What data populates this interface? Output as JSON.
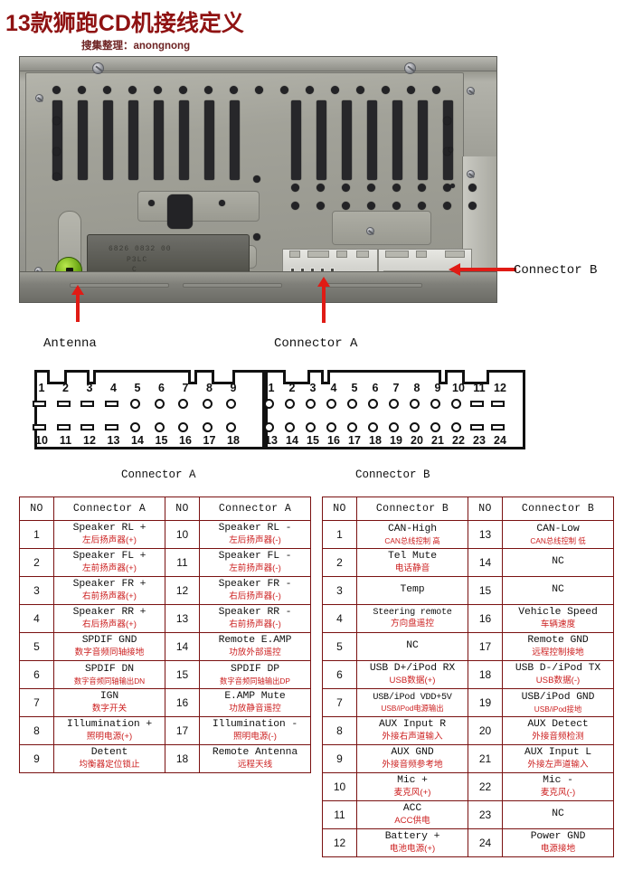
{
  "header": {
    "title": "13款狮跑CD机接线定义",
    "subtitle": "搜集整理：anongnong",
    "title_color": "#8f1212",
    "accent_red": "#cc1f1f",
    "table_border_color": "#7a1111"
  },
  "photo": {
    "alt_name": "car-cd-unit-rear-photo",
    "plate_text_line1": "6826 0832 00",
    "plate_text_line2": "P3LC",
    "plate_text_line3": "C",
    "labels": {
      "antenna": "Antenna",
      "connector_a": "Connector A",
      "connector_b": "Connector B"
    }
  },
  "pinout_diagram": {
    "connector_a": {
      "caption": "Connector A",
      "top_row": [
        "1",
        "2",
        "3",
        "4",
        "5",
        "6",
        "7",
        "8",
        "9"
      ],
      "bottom_row": [
        "10",
        "11",
        "12",
        "13",
        "14",
        "15",
        "16",
        "17",
        "18"
      ],
      "top_shapes": [
        "rect",
        "rect",
        "rect",
        "rect",
        "circle",
        "circle",
        "circle",
        "circle",
        "circle"
      ],
      "bottom_shapes": [
        "rect",
        "rect",
        "rect",
        "rect",
        "circle",
        "circle",
        "circle",
        "circle",
        "circle"
      ]
    },
    "connector_b": {
      "caption": "Connector B",
      "top_row": [
        "1",
        "2",
        "3",
        "4",
        "5",
        "6",
        "7",
        "8",
        "9",
        "10",
        "11",
        "12"
      ],
      "bottom_row": [
        "13",
        "14",
        "15",
        "16",
        "17",
        "18",
        "19",
        "20",
        "21",
        "22",
        "23",
        "24"
      ],
      "top_shapes": [
        "circle",
        "circle",
        "circle",
        "circle",
        "circle",
        "circle",
        "circle",
        "circle",
        "circle",
        "circle",
        "rect",
        "rect"
      ],
      "bottom_shapes": [
        "circle",
        "circle",
        "circle",
        "circle",
        "circle",
        "circle",
        "circle",
        "circle",
        "circle",
        "circle",
        "rect",
        "rect"
      ]
    }
  },
  "table_a": {
    "headers": [
      "NO",
      "Connector A",
      "NO",
      "Connector A"
    ],
    "rows": [
      {
        "no_left": "1",
        "en_left": "Speaker RL +",
        "cn_left": "左后扬声器(+)",
        "no_right": "10",
        "en_right": "Speaker RL -",
        "cn_right": "左后扬声器(-)"
      },
      {
        "no_left": "2",
        "en_left": "Speaker FL +",
        "cn_left": "左前扬声器(+)",
        "no_right": "11",
        "en_right": "Speaker FL -",
        "cn_right": "左前扬声器(-)"
      },
      {
        "no_left": "3",
        "en_left": "Speaker FR +",
        "cn_left": "右前扬声器(+)",
        "no_right": "12",
        "en_right": "Speaker FR -",
        "cn_right": "右后扬声器(-)"
      },
      {
        "no_left": "4",
        "en_left": "Speaker RR +",
        "cn_left": "右后扬声器(+)",
        "no_right": "13",
        "en_right": "Speaker RR -",
        "cn_right": "右前扬声器(-)"
      },
      {
        "no_left": "5",
        "en_left": "SPDIF GND",
        "cn_left": "数字音频同轴接地",
        "no_right": "14",
        "en_right": "Remote E.AMP",
        "cn_right": "功放外部遥控"
      },
      {
        "no_left": "6",
        "en_left": "SPDIF DN",
        "cn_left": "数字音频同轴输出DN",
        "no_right": "15",
        "en_right": "SPDIF DP",
        "cn_right": "数字音频同轴输出DP"
      },
      {
        "no_left": "7",
        "en_left": "IGN",
        "cn_left": "数字开关",
        "no_right": "16",
        "en_right": "E.AMP Mute",
        "cn_right": "功放静音遥控"
      },
      {
        "no_left": "8",
        "en_left": "Illumination +",
        "cn_left": "照明电源(+)",
        "no_right": "17",
        "en_right": "Illumination -",
        "cn_right": "照明电源(-)"
      },
      {
        "no_left": "9",
        "en_left": "Detent",
        "cn_left": "均衡器定位锁止",
        "no_right": "18",
        "en_right": "Remote Antenna",
        "cn_right": "远程天线"
      }
    ]
  },
  "table_b": {
    "headers": [
      "NO",
      "Connector B",
      "NO",
      "Connector B"
    ],
    "rows": [
      {
        "no_left": "1",
        "en_left": "CAN-High",
        "cn_left": "CAN总线控制 高",
        "no_right": "13",
        "en_right": "CAN-Low",
        "cn_right": "CAN总线控制 低"
      },
      {
        "no_left": "2",
        "en_left": "Tel Mute",
        "cn_left": "电话静音",
        "no_right": "14",
        "en_right": "NC",
        "cn_right": ""
      },
      {
        "no_left": "3",
        "en_left": "Temp",
        "cn_left": "",
        "no_right": "15",
        "en_right": "NC",
        "cn_right": ""
      },
      {
        "no_left": "4",
        "en_left": "Steering remote",
        "cn_left": "方向盘遥控",
        "no_right": "16",
        "en_right": "Vehicle Speed",
        "cn_right": "车辆速度"
      },
      {
        "no_left": "5",
        "en_left": "NC",
        "cn_left": "",
        "no_right": "17",
        "en_right": "Remote GND",
        "cn_right": "远程控制接地"
      },
      {
        "no_left": "6",
        "en_left": "USB D+/iPod RX",
        "cn_left": "USB数据(+)",
        "no_right": "18",
        "en_right": "USB D-/iPod TX",
        "cn_right": "USB数据(-)"
      },
      {
        "no_left": "7",
        "en_left": "USB/iPod VDD+5V",
        "cn_left": "USB/iPod电源输出",
        "no_right": "19",
        "en_right": "USB/iPod GND",
        "cn_right": "USB/iPod接地"
      },
      {
        "no_left": "8",
        "en_left": "AUX Input R",
        "cn_left": "外接右声道输入",
        "no_right": "20",
        "en_right": "AUX Detect",
        "cn_right": "外接音频检测"
      },
      {
        "no_left": "9",
        "en_left": "AUX GND",
        "cn_left": "外接音频参考地",
        "no_right": "21",
        "en_right": "AUX Input L",
        "cn_right": "外接左声道输入"
      },
      {
        "no_left": "10",
        "en_left": "Mic +",
        "cn_left": "麦克风(+)",
        "no_right": "22",
        "en_right": "Mic -",
        "cn_right": "麦克风(-)"
      },
      {
        "no_left": "11",
        "en_left": "ACC",
        "cn_left": "ACC供电",
        "no_right": "23",
        "en_right": "NC",
        "cn_right": ""
      },
      {
        "no_left": "12",
        "en_left": "Battery +",
        "cn_left": "电池电源(+)",
        "no_right": "24",
        "en_right": "Power GND",
        "cn_right": "电源接地"
      }
    ]
  }
}
